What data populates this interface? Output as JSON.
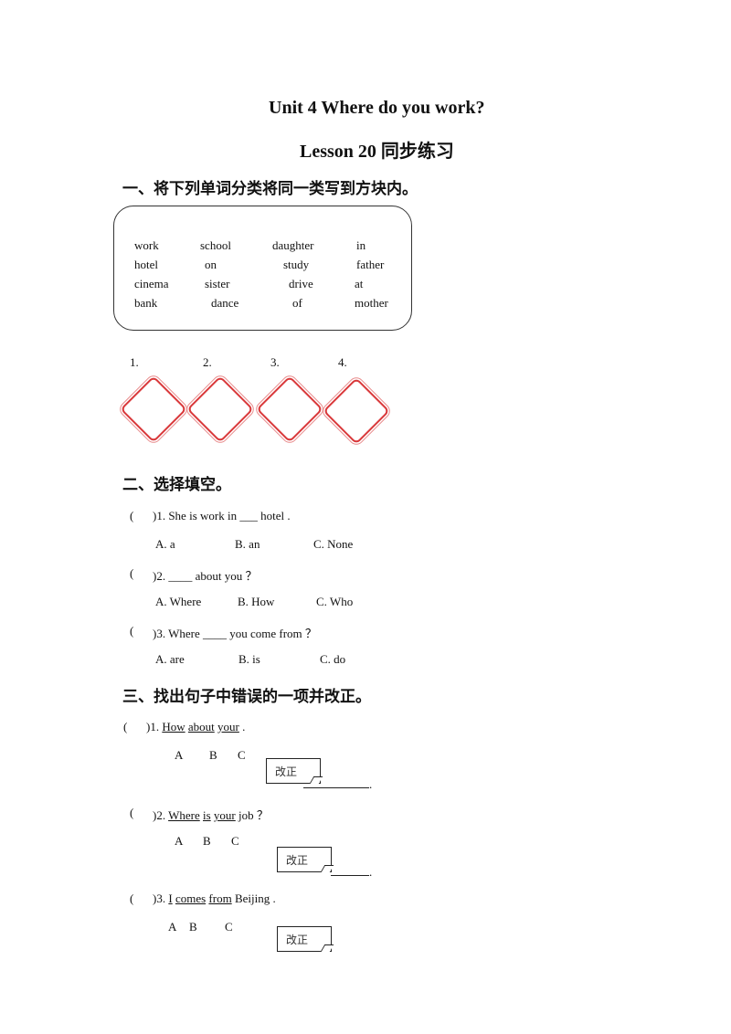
{
  "header": {
    "title": "Unit 4 Where do you work?",
    "subtitle": "Lesson 20  同步练习"
  },
  "section1": {
    "heading": "一、将下列单词分类将同一类写到方块内。",
    "words": [
      [
        "work",
        "school",
        "daughter",
        "in"
      ],
      [
        "hotel",
        "on",
        "study",
        "father"
      ],
      [
        "cinema",
        "sister",
        "drive",
        "at"
      ],
      [
        "bank",
        "dance",
        "of",
        "mother"
      ]
    ],
    "boxes": [
      "1.",
      "2.",
      "3.",
      "4."
    ],
    "box_color": "#d9383a"
  },
  "section2": {
    "heading": "二、选择填空。",
    "questions": [
      {
        "bracket": "(",
        "text": ")1. She is work in ___ hotel .",
        "options": [
          "A. a",
          "B. an",
          "C. None"
        ]
      },
      {
        "bracket": "(",
        "text": ")2. ____ about you ？",
        "options": [
          "A. Where",
          "B. How",
          "C. Who"
        ]
      },
      {
        "bracket": "(",
        "text": ")3. Where ____ you come from ？",
        "options": [
          "A. are",
          "B. is",
          "C. do"
        ]
      }
    ]
  },
  "section3": {
    "heading": "三、找出句子中错误的一项并改正。",
    "fix_label": "改正",
    "questions": [
      {
        "bracket": "(",
        "prefix": ")1. ",
        "parts": [
          "How",
          "about",
          "your"
        ],
        "suffix": " .",
        "letters": [
          "A",
          "B",
          "C"
        ]
      },
      {
        "bracket": "(",
        "prefix": ")2. ",
        "parts": [
          "Where",
          "is",
          "your"
        ],
        "suffix": " job ？",
        "letters": [
          "A",
          "B",
          "C"
        ]
      },
      {
        "bracket": "(",
        "prefix": ")3. ",
        "parts": [
          "I",
          "comes",
          "from"
        ],
        "suffix": " Beijing .",
        "letters": [
          "A",
          "B",
          "C"
        ]
      }
    ]
  }
}
